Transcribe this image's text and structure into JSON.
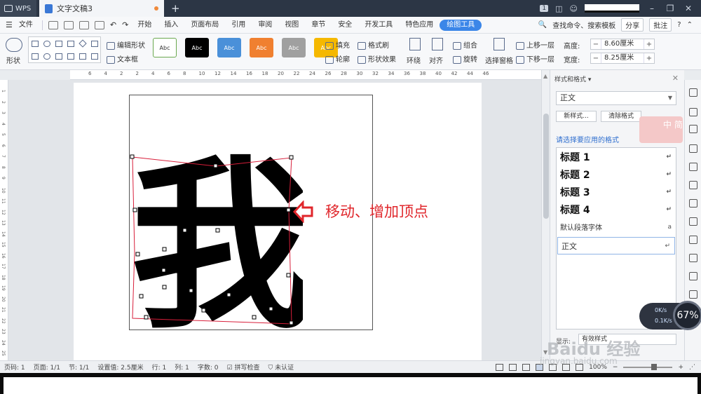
{
  "titlebar": {
    "app": "WPS",
    "doc_tab": "文字文稿3",
    "add_tab": "+",
    "badge": "1"
  },
  "menubar": {
    "file": "文件",
    "tabs": [
      "开始",
      "插入",
      "页面布局",
      "引用",
      "审阅",
      "视图",
      "章节",
      "安全",
      "开发工具",
      "特色应用",
      "绘图工具"
    ],
    "search": "查找命令、搜索模板",
    "share": "分享",
    "comment": "批注",
    "help": "?"
  },
  "ribbon": {
    "shape_label": "形状",
    "edit_shape": "编辑形状",
    "text_box": "文本框",
    "style_samples": [
      {
        "label": "Abc",
        "bg": "#ffffff",
        "fg": "#333333",
        "border": "#6aa84f"
      },
      {
        "label": "Abc",
        "bg": "#000000",
        "fg": "#ffffff",
        "border": "#000000"
      },
      {
        "label": "Abc",
        "bg": "#4a90d9",
        "fg": "#ffffff",
        "border": "#4a90d9"
      },
      {
        "label": "Abc",
        "bg": "#f08030",
        "fg": "#ffffff",
        "border": "#f08030"
      },
      {
        "label": "Abc",
        "bg": "#a0a0a0",
        "fg": "#ffffff",
        "border": "#a0a0a0"
      },
      {
        "label": "Abc",
        "bg": "#f5b800",
        "fg": "#ffffff",
        "border": "#f5b800"
      }
    ],
    "fill": "填充",
    "format_painter": "格式刷",
    "outline": "轮廓",
    "shape_effect": "形状效果",
    "wrap": "环绕",
    "align": "对齐",
    "group": "组合",
    "rotate": "旋转",
    "select_pane": "选择窗格",
    "bring_forward": "上移一层",
    "send_backward": "下移一层",
    "height_label": "高度:",
    "height_value": "8.60厘米",
    "width_label": "宽度:",
    "width_value": "8.25厘米"
  },
  "ruler": [
    "6",
    "4",
    "2",
    "2",
    "4",
    "6",
    "8",
    "10",
    "12",
    "14",
    "16",
    "18",
    "20",
    "22",
    "24",
    "26",
    "28",
    "30",
    "32",
    "34",
    "36",
    "38",
    "40",
    "42",
    "44",
    "46"
  ],
  "vruler": [
    "1",
    "2",
    "3",
    "4",
    "5",
    "6",
    "7",
    "8",
    "9",
    "10",
    "11",
    "12",
    "13",
    "14",
    "15",
    "16",
    "17",
    "18",
    "19",
    "20",
    "21",
    "22",
    "23",
    "24",
    "25"
  ],
  "document": {
    "glyph": "我",
    "annotation": "移动、增加顶点",
    "glyph_color": "#000000",
    "outline_color": "#d81e3a",
    "annotation_color": "#e0262b"
  },
  "panel": {
    "title": "样式和格式 ▾",
    "current_style": "正文",
    "new_style": "新样式...",
    "clear_format": "清除格式",
    "pick_label": "请选择要应用的格式",
    "styles": [
      {
        "name": "标题 1",
        "mark": "↵"
      },
      {
        "name": "标题 2",
        "mark": "↵"
      },
      {
        "name": "标题 3",
        "mark": "↵"
      },
      {
        "name": "标题 4",
        "mark": "↵"
      }
    ],
    "default_font": "默认段落字体",
    "default_font_mark": "a",
    "body_style": "正文",
    "body_mark": "↵",
    "show_label": "显示:",
    "show_value": "有效样式"
  },
  "ime": {
    "text": "中 简"
  },
  "speed": {
    "up": "0K/s",
    "down": "0.1K/s",
    "percent": "67%"
  },
  "status": {
    "page_num": "页码: 1",
    "pages": "页面: 1/1",
    "section": "节: 1/1",
    "setting": "设置值: 2.5厘米",
    "row": "行: 1",
    "col": "列: 1",
    "words": "字数: 0",
    "spell": "拼写检查",
    "cert": "未认证",
    "zoom": "100%"
  },
  "watermark": {
    "main": "Baidu 经验",
    "url": "jingyan.baidu.com"
  }
}
